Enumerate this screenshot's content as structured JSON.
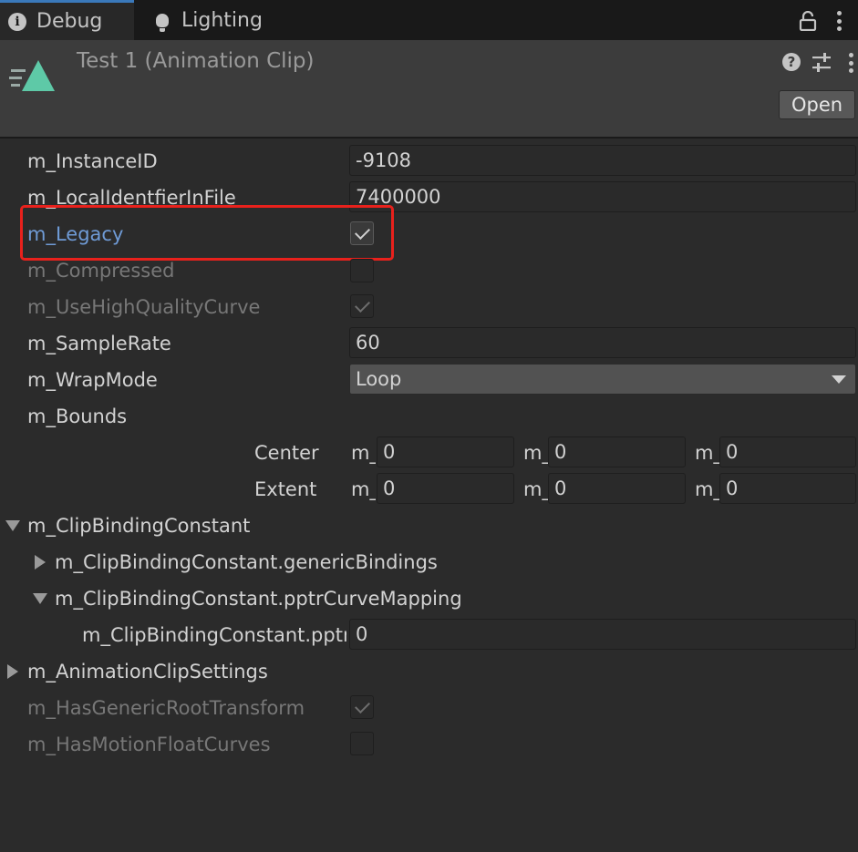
{
  "tabs": [
    {
      "label": "Debug",
      "icon": "info-icon",
      "active": true
    },
    {
      "label": "Lighting",
      "icon": "lightbulb-icon",
      "active": false
    }
  ],
  "header": {
    "title": "Test 1 (Animation Clip)",
    "open_label": "Open",
    "accent_color": "#5ec9a7"
  },
  "properties": {
    "instance_id": {
      "label": "m_InstanceID",
      "value": "-9108"
    },
    "local_identifier": {
      "label": "m_LocalIdentfierInFile",
      "value": "7400000"
    },
    "legacy": {
      "label": "m_Legacy",
      "checked": true
    },
    "compressed": {
      "label": "m_Compressed",
      "checked": false
    },
    "use_high_quality_curve": {
      "label": "m_UseHighQualityCurve",
      "checked": true
    },
    "sample_rate": {
      "label": "m_SampleRate",
      "value": "60"
    },
    "wrap_mode": {
      "label": "m_WrapMode",
      "value": "Loop"
    },
    "bounds": {
      "label": "m_Bounds",
      "center": {
        "label": "Center",
        "axis_label": "m_",
        "x": "0",
        "y": "0",
        "z": "0"
      },
      "extent": {
        "label": "Extent",
        "axis_label": "m_",
        "x": "0",
        "y": "0",
        "z": "0"
      }
    },
    "clip_binding_constant": {
      "label": "m_ClipBindingConstant",
      "generic_bindings": {
        "label": "m_ClipBindingConstant.genericBindings"
      },
      "pptr_curve_mapping": {
        "label": "m_ClipBindingConstant.pptrCurveMapping"
      },
      "pptr_size": {
        "label": "m_ClipBindingConstant.pptrCurveMapping.Array.size",
        "value": "0"
      }
    },
    "animation_clip_settings": {
      "label": "m_AnimationClipSettings"
    },
    "has_generic_root_transform": {
      "label": "m_HasGenericRootTransform",
      "checked": true
    },
    "has_motion_float_curves": {
      "label": "m_HasMotionFloatCurves",
      "checked": false
    }
  },
  "highlight_color": "#e8211c"
}
